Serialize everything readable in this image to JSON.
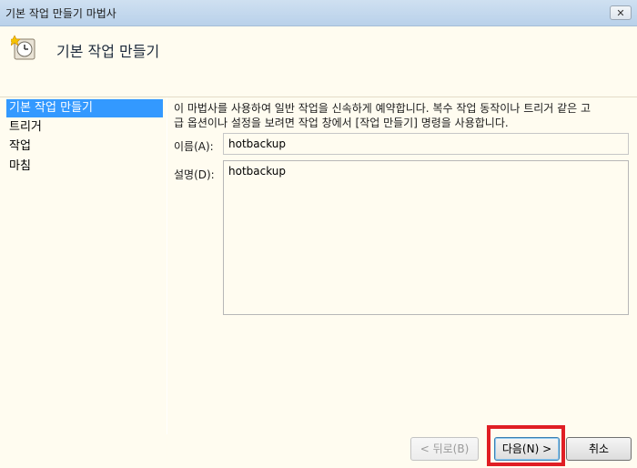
{
  "window": {
    "title": "기본 작업 만들기 마법사",
    "close_label": "✕"
  },
  "header": {
    "title": "기본 작업 만들기",
    "icon": "clock-task-icon"
  },
  "sidebar": {
    "items": [
      {
        "label": "기본 작업 만들기",
        "active": true
      },
      {
        "label": "트리거",
        "active": false
      },
      {
        "label": "작업",
        "active": false
      },
      {
        "label": "마침",
        "active": false
      }
    ]
  },
  "main": {
    "description_line1": "이 마법사를 사용하여 일반 작업을 신속하게 예약합니다. 복수 작업 동작이나 트리거 같은 고",
    "description_line2": "급 옵션이나 설정을 보려면 작업 창에서 [작업 만들기] 명령을 사용합니다.",
    "name_label": "이름(A):",
    "name_value": "hotbackup",
    "desc_label": "설명(D):",
    "desc_value": "hotbackup"
  },
  "footer": {
    "back_label": "< 뒤로(B)",
    "next_label": "다음(N) >",
    "cancel_label": "취소"
  },
  "colors": {
    "highlight": "#e01e24",
    "selection": "#3399ff",
    "panel_bg": "#fffcf0"
  }
}
